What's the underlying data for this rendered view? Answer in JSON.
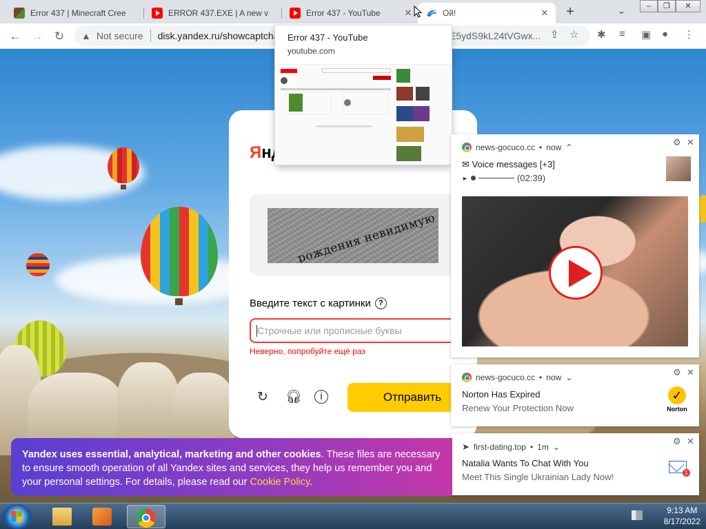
{
  "tabs": [
    {
      "title": "Error 437 | Minecraft Cree",
      "icon": "minecraft-icon"
    },
    {
      "title": "ERROR 437.EXE | A new v",
      "icon": "youtube-icon"
    },
    {
      "title": "Error 437 - YouTube",
      "icon": "youtube-icon"
    },
    {
      "title": "Ой!",
      "icon": "yandex-disk-icon",
      "active": true
    }
  ],
  "toolbar": {
    "security": "Not secure",
    "url_host": "disk.yandex.ru/showcaptcha",
    "url_tail": "E5ydS9kL24tVGwx..."
  },
  "preview": {
    "title": "Error 437 - YouTube",
    "url": "youtube.com"
  },
  "captcha": {
    "logo_ya": "Я",
    "logo_rest": "нд",
    "text": "рождения невидимую",
    "label": "Введите текст с картинки",
    "help": "?",
    "placeholder": "Строчные или прописные буквы",
    "error": "Неверно, попробуйте ещё раз",
    "submit": "Отправить"
  },
  "notifications": [
    {
      "source": "news-gocuco.cc",
      "time": "now",
      "title": "Voice messages [+3]",
      "audio_time": "(02:39)"
    },
    {
      "source": "news-gocuco.cc",
      "time": "now",
      "title": "Norton Has Expired",
      "body": "Renew Your Protection Now",
      "brand": "Norton"
    },
    {
      "source": "first-dating.top",
      "time": "1m",
      "title": "Natalia Wants To Chat With You",
      "body": "Meet This Single Ukrainian Lady Now!",
      "badge": "1"
    }
  ],
  "cookie": {
    "bold": "Yandex uses essential, analytical, marketing and other cookies",
    "text": ". These files are necessary to ensure smooth operation of all Yandex sites and services, they help us remember you and your personal settings. For details, please read our ",
    "link": "Cookie Policy",
    "end": "."
  },
  "taskbar": {
    "time": "9:13 AM",
    "date": "8/17/2022"
  },
  "colors": {
    "yandex_red": "#fc3f1d",
    "submit_yellow": "#ffcc00",
    "error_red": "#ff0000"
  }
}
